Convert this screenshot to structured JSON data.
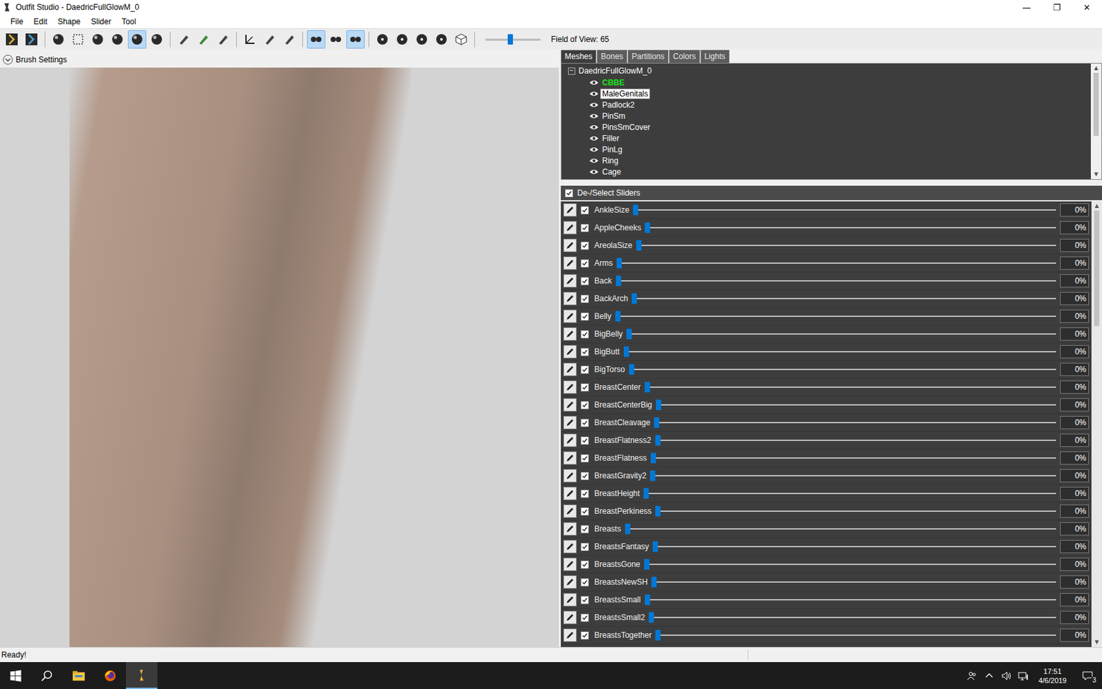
{
  "window": {
    "title": "Outfit Studio - DaedricFullGlowM_0",
    "controls": [
      "—",
      "❐",
      "✕"
    ]
  },
  "menu": [
    "File",
    "Edit",
    "Shape",
    "Slider",
    "Tool"
  ],
  "toolbar": {
    "tools": [
      {
        "kind": "logo",
        "selected": false
      },
      {
        "kind": "logo2",
        "selected": false
      },
      {
        "kind": "sep",
        "selected": false
      },
      {
        "kind": "brush",
        "selected": false
      },
      {
        "kind": "select",
        "selected": false
      },
      {
        "kind": "inflate",
        "selected": false
      },
      {
        "kind": "deflate",
        "selected": false
      },
      {
        "kind": "move",
        "selected": true
      },
      {
        "kind": "smooth",
        "selected": false
      },
      {
        "kind": "sep",
        "selected": false
      },
      {
        "kind": "mask",
        "selected": false
      },
      {
        "kind": "color",
        "selected": false
      },
      {
        "kind": "alpha",
        "selected": false
      },
      {
        "kind": "sep",
        "selected": false
      },
      {
        "kind": "transform",
        "selected": false
      },
      {
        "kind": "pin",
        "selected": false
      },
      {
        "kind": "eraser",
        "selected": false
      },
      {
        "kind": "sep",
        "selected": false
      },
      {
        "kind": "mirror",
        "selected": true
      },
      {
        "kind": "connected",
        "selected": false
      },
      {
        "kind": "xmirror",
        "selected": true
      },
      {
        "kind": "sep",
        "selected": false
      },
      {
        "kind": "dot",
        "selected": false
      },
      {
        "kind": "dot",
        "selected": false
      },
      {
        "kind": "dot",
        "selected": false
      },
      {
        "kind": "dot",
        "selected": false
      },
      {
        "kind": "cube",
        "selected": false
      },
      {
        "kind": "sep",
        "selected": false
      }
    ],
    "fov": {
      "label": "Field of View: 65",
      "level": 0.45
    }
  },
  "brush_settings": {
    "label": "Brush Settings"
  },
  "tabs": [
    {
      "label": "Meshes",
      "selected": true
    },
    {
      "label": "Bones",
      "selected": false
    },
    {
      "label": "Partitions",
      "selected": false
    },
    {
      "label": "Colors",
      "selected": false
    },
    {
      "label": "Lights",
      "selected": false
    }
  ],
  "mesh_tree": {
    "root": {
      "label": "DaedricFullGlowM_0",
      "expanded": true,
      "toggle": "−"
    },
    "items": [
      {
        "label": "CBBE",
        "visible": true,
        "selected": false,
        "color": "#19e619"
      },
      {
        "label": "MaleGenitals",
        "visible": true,
        "selected": true,
        "color": "#ffffff"
      },
      {
        "label": "Padlock2",
        "visible": true,
        "selected": false,
        "color": "#ffffff"
      },
      {
        "label": "PinSm",
        "visible": true,
        "selected": false,
        "color": "#ffffff"
      },
      {
        "label": "PinsSmCover",
        "visible": true,
        "selected": false,
        "color": "#ffffff"
      },
      {
        "label": "Filler",
        "visible": true,
        "selected": false,
        "color": "#ffffff"
      },
      {
        "label": "PinLg",
        "visible": true,
        "selected": false,
        "color": "#ffffff"
      },
      {
        "label": "Ring",
        "visible": true,
        "selected": false,
        "color": "#ffffff"
      },
      {
        "label": "Cage",
        "visible": true,
        "selected": false,
        "color": "#ffffff"
      }
    ]
  },
  "sliders": {
    "header": "De-/Select Sliders",
    "all_checked": true,
    "rows": [
      {
        "name": "AnkleSize",
        "checked": true,
        "level": 0,
        "reading": "0%"
      },
      {
        "name": "AppleCheeks",
        "checked": true,
        "level": 0,
        "reading": "0%"
      },
      {
        "name": "AreolaSize",
        "checked": true,
        "level": 0,
        "reading": "0%"
      },
      {
        "name": "Arms",
        "checked": true,
        "level": 0,
        "reading": "0%"
      },
      {
        "name": "Back",
        "checked": true,
        "level": 0,
        "reading": "0%"
      },
      {
        "name": "BackArch",
        "checked": true,
        "level": 0,
        "reading": "0%"
      },
      {
        "name": "Belly",
        "checked": true,
        "level": 0,
        "reading": "0%"
      },
      {
        "name": "BigBelly",
        "checked": true,
        "level": 0,
        "reading": "0%"
      },
      {
        "name": "BigButt",
        "checked": true,
        "level": 0,
        "reading": "0%"
      },
      {
        "name": "BigTorso",
        "checked": true,
        "level": 0,
        "reading": "0%"
      },
      {
        "name": "BreastCenter",
        "checked": true,
        "level": 0,
        "reading": "0%"
      },
      {
        "name": "BreastCenterBig",
        "checked": true,
        "level": 0,
        "reading": "0%"
      },
      {
        "name": "BreastCleavage",
        "checked": true,
        "level": 0,
        "reading": "0%"
      },
      {
        "name": "BreastFlatness2",
        "checked": true,
        "level": 0,
        "reading": "0%"
      },
      {
        "name": "BreastFlatness",
        "checked": true,
        "level": 0,
        "reading": "0%"
      },
      {
        "name": "BreastGravity2",
        "checked": true,
        "level": 0,
        "reading": "0%"
      },
      {
        "name": "BreastHeight",
        "checked": true,
        "level": 0,
        "reading": "0%"
      },
      {
        "name": "BreastPerkiness",
        "checked": true,
        "level": 0,
        "reading": "0%"
      },
      {
        "name": "Breasts",
        "checked": true,
        "level": 0,
        "reading": "0%"
      },
      {
        "name": "BreastsFantasy",
        "checked": true,
        "level": 0,
        "reading": "0%"
      },
      {
        "name": "BreastsGone",
        "checked": true,
        "level": 0,
        "reading": "0%"
      },
      {
        "name": "BreastsNewSH",
        "checked": true,
        "level": 0,
        "reading": "0%"
      },
      {
        "name": "BreastsSmall",
        "checked": true,
        "level": 0,
        "reading": "0%"
      },
      {
        "name": "BreastsSmall2",
        "checked": true,
        "level": 0,
        "reading": "0%"
      },
      {
        "name": "BreastsTogether",
        "checked": true,
        "level": 0,
        "reading": "0%"
      }
    ]
  },
  "status_bar": {
    "text": "Ready!"
  },
  "taskbar": {
    "apps": [
      {
        "kind": "start",
        "selected": false
      },
      {
        "kind": "search",
        "selected": false
      },
      {
        "kind": "explorer",
        "selected": false
      },
      {
        "kind": "firefox",
        "selected": false
      },
      {
        "kind": "outfit",
        "selected": true
      }
    ],
    "tray": [
      {
        "kind": "people"
      },
      {
        "kind": "chevron"
      },
      {
        "kind": "volume"
      },
      {
        "kind": "network"
      }
    ],
    "time": "17:51",
    "date": "4/6/2019",
    "notifications": "3"
  }
}
